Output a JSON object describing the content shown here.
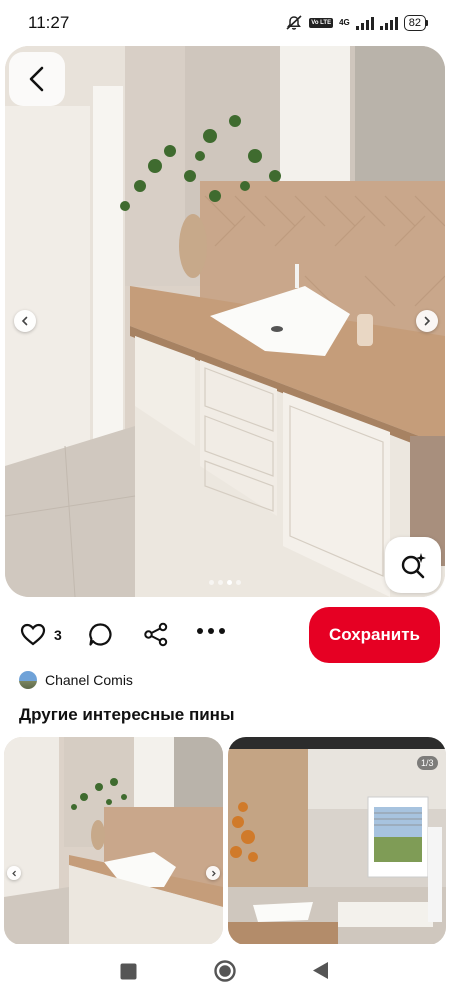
{
  "status_bar": {
    "time": "11:27",
    "network": "4G",
    "lte_badge": "Vo LTE",
    "battery": "82"
  },
  "pin": {
    "carousel": {
      "count": 4,
      "active_index": 2
    },
    "likes_count": "3",
    "save_label": "Сохранить",
    "author_name": "Chanel Comis"
  },
  "section": {
    "title": "Другие интересные пины"
  },
  "grid": {
    "right_image_counter": "1/3"
  },
  "icons": {
    "back": "chevron-left-icon",
    "lens": "visual-search-icon",
    "like": "heart-icon",
    "comment": "comment-bubble-icon",
    "share": "share-icon",
    "more": "more-dots-icon"
  },
  "colors": {
    "accent": "#e60023"
  }
}
